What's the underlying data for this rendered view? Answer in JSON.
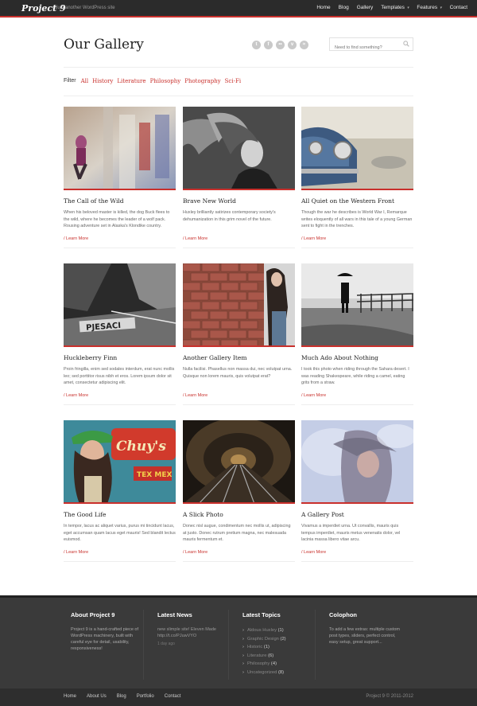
{
  "site": {
    "logo": "Project 9",
    "tagline": "/ Just another WordPress site"
  },
  "nav": {
    "items": [
      "Home",
      "Blog",
      "Gallery",
      "Templates",
      "Features",
      "Contact"
    ]
  },
  "header": {
    "title": "Our Gallery",
    "social_icons": [
      "twitter-icon",
      "facebook-icon",
      "flickr-icon",
      "vimeo-icon",
      "rss-icon"
    ],
    "search_placeholder": "Need to find something?"
  },
  "filter": {
    "label": "Filter",
    "options": [
      "All",
      "History",
      "Literature",
      "Philosophy",
      "Photography",
      "Sci-Fi"
    ]
  },
  "gallery": [
    {
      "title": "The Call of the Wild",
      "desc": "When his beloved master is killed, the dog Buck flees to the wild, where he becomes the leader of a wolf pack. Rousing adventure set in Alaska's Klondike country.",
      "more": "/ Learn More"
    },
    {
      "title": "Brave New World",
      "desc": "Huxley brilliantly satirizes contemporary society's dehumanization in this grim novel of the future.",
      "more": "/ Learn More"
    },
    {
      "title": "All Quiet on the Western Front",
      "desc": "Though the war he describes is World War I, Remarque writes eloquently of all wars in this tale of a young German sent to fight in the trenches.",
      "more": "/ Learn More"
    },
    {
      "title": "Huckleberry Finn",
      "desc": "Proin fringilla, enim sed sodales interdum, erat nunc mollis leo; sed porttitor risus nibh et eros. Lorem ipsum dolor sit amet, consectetur adipiscing elit.",
      "more": "/ Learn More"
    },
    {
      "title": "Another Gallery Item",
      "desc": "Nulla facilisi. Phasellus non massa dui, nec volutpat urna. Quisque non lorem mauris, quis volutpat erat?",
      "more": "/ Learn More"
    },
    {
      "title": "Much Ado About Nothing",
      "desc": "I took this photo when riding through the Sahara desert. I was reading Shakespeare, while riding a camel, eating grits from a straw.",
      "more": "/ Learn More"
    },
    {
      "title": "The Good Life",
      "desc": "In tempor, lacus ac aliquet varius, purus mi tincidunt lacus, eget accumsan quam lacus eget mauris! Sed blandit lectus euismod.",
      "more": "/ Learn More"
    },
    {
      "title": "A Slick Photo",
      "desc": "Donec nisl augue, condimentum nec mollis ut, adipiscing at justo. Donec rutrum pretium magna, nec malesuada mauris fermentum et.",
      "more": "/ Learn More"
    },
    {
      "title": "A Gallery Post",
      "desc": "Vivamus a imperdiet urna. Ut convallis, mauris quis tempus imperdiet, mauris metus venenatis dolor, vel lacinia massa libero vitae arcu.",
      "more": "/ Learn More"
    }
  ],
  "footer": {
    "about": {
      "title": "About Project 9",
      "text": "Project 9 is a hand-crafted piece of WordPress machinery, built with careful eye for detail, usability, responsiveness!"
    },
    "news": {
      "title": "Latest News",
      "text": "new slimple site! Eleven Made http://t.co/PJuwVYO",
      "time": "1 day ago"
    },
    "topics": {
      "title": "Latest Topics",
      "items": [
        {
          "name": "Aldous Huxley",
          "count": "(1)"
        },
        {
          "name": "Graphic Design",
          "count": "(2)"
        },
        {
          "name": "Historic",
          "count": "(1)"
        },
        {
          "name": "Literature",
          "count": "(6)"
        },
        {
          "name": "Philosophy",
          "count": "(4)"
        },
        {
          "name": "Uncategorized",
          "count": "(8)"
        }
      ]
    },
    "colophon": {
      "title": "Colophon",
      "text": "To add a few extras: multiple custom post types, sliders, perfect control, easy setup, great support..."
    },
    "links": [
      "Home",
      "About Us",
      "Blog",
      "Portfolio",
      "Contact"
    ],
    "copyright": "Project 9 © 2011-2012"
  },
  "colors": {
    "accent": "#c9302c",
    "footer": "#3a3a3a",
    "topbar": "#2b2b2b"
  }
}
